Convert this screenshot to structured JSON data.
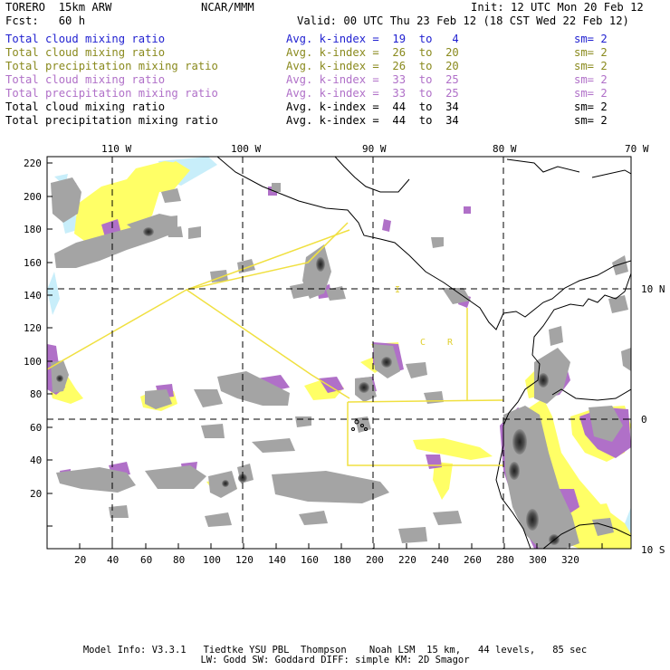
{
  "header": {
    "model": "TORERO  15km ARW",
    "org": "NCAR/MMM",
    "init": "Init: 12 UTC Mon 20 Feb 12",
    "fcst": "Fcst:   60 h",
    "valid": "Valid: 00 UTC Thu 23 Feb 12 (18 CST Wed 22 Feb 12)"
  },
  "legend": [
    {
      "field": "Total cloud mixing ratio",
      "kindex": "Avg. k-index =  19  to   4",
      "sm": "sm= 2",
      "color": "#1f1fd0"
    },
    {
      "field": "Total cloud mixing ratio",
      "kindex": "Avg. k-index =  26  to  20",
      "sm": "sm= 2",
      "color": "#8a8a1e"
    },
    {
      "field": "Total precipitation mixing ratio",
      "kindex": "Avg. k-index =  26  to  20",
      "sm": "sm= 2",
      "color": "#8a8a1e"
    },
    {
      "field": "Total cloud mixing ratio",
      "kindex": "Avg. k-index =  33  to  25",
      "sm": "sm= 2",
      "color": "#b070c8"
    },
    {
      "field": "Total precipitation mixing ratio",
      "kindex": "Avg. k-index =  33  to  25",
      "sm": "sm= 2",
      "color": "#b070c8"
    },
    {
      "field": "Total cloud mixing ratio",
      "kindex": "Avg. k-index =  44  to  34",
      "sm": "sm= 2",
      "color": "#000000"
    },
    {
      "field": "Total precipitation mixing ratio",
      "kindex": "Avg. k-index =  44  to  34",
      "sm": "sm= 2",
      "color": "#000000"
    }
  ],
  "axes": {
    "top_lon": [
      "110 W",
      "100 W",
      "90 W",
      "80 W",
      "70 W"
    ],
    "right_lat": [
      "10 N",
      "0",
      "10 S"
    ],
    "left_y": [
      "220",
      "200",
      "180",
      "160",
      "140",
      "120",
      "100",
      "80",
      "60",
      "40",
      "20"
    ],
    "bottom_x": [
      "20",
      "40",
      "60",
      "80",
      "100",
      "120",
      "140",
      "160",
      "180",
      "200",
      "220",
      "240",
      "260",
      "280",
      "300",
      "320"
    ]
  },
  "map_labels": {
    "region_c": "C",
    "region_r": "R",
    "region_i": "I"
  },
  "colors": {
    "light_blue": "#c8eefa",
    "yellow": "#ffff66",
    "purple": "#b070c8",
    "gray": "#a0a0a0",
    "dark": "#303030",
    "domain_line": "#f0e040"
  },
  "footer": {
    "line1": "Model Info: V3.3.1   Tiedtke YSU PBL  Thompson    Noah LSM  15 km,   44 levels,   85 sec",
    "line2": "LW: Godd SW: Goddard DIFF: simple KM: 2D Smagor"
  }
}
